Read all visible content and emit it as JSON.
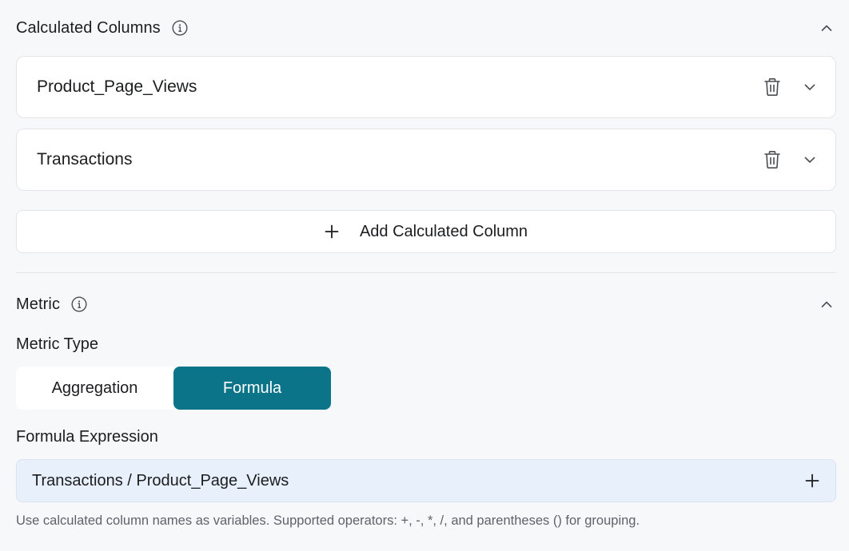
{
  "calculated_columns": {
    "title": "Calculated Columns",
    "info_icon": "info-icon",
    "collapse_icon": "chevron-up-icon",
    "items": [
      {
        "name": "Product_Page_Views",
        "delete_icon": "trash-icon",
        "expand_icon": "chevron-down-icon"
      },
      {
        "name": "Transactions",
        "delete_icon": "trash-icon",
        "expand_icon": "chevron-down-icon"
      }
    ],
    "add_button": {
      "icon": "plus-icon",
      "label": "Add Calculated Column"
    }
  },
  "metric": {
    "title": "Metric",
    "info_icon": "info-icon",
    "collapse_icon": "chevron-up-icon",
    "metric_type_label": "Metric Type",
    "options": [
      {
        "label": "Aggregation",
        "selected": false
      },
      {
        "label": "Formula",
        "selected": true
      }
    ],
    "formula_label": "Formula Expression",
    "formula_value": "Transactions / Product_Page_Views",
    "formula_add_icon": "plus-icon",
    "help_text": "Use calculated column names as variables. Supported operators: +, -, *, /, and parentheses () for grouping."
  },
  "colors": {
    "accent": "#0b7489",
    "background": "#f7f8fa",
    "card": "#ffffff",
    "input_bg": "#e8f0fc",
    "muted_text": "#5f6368"
  }
}
